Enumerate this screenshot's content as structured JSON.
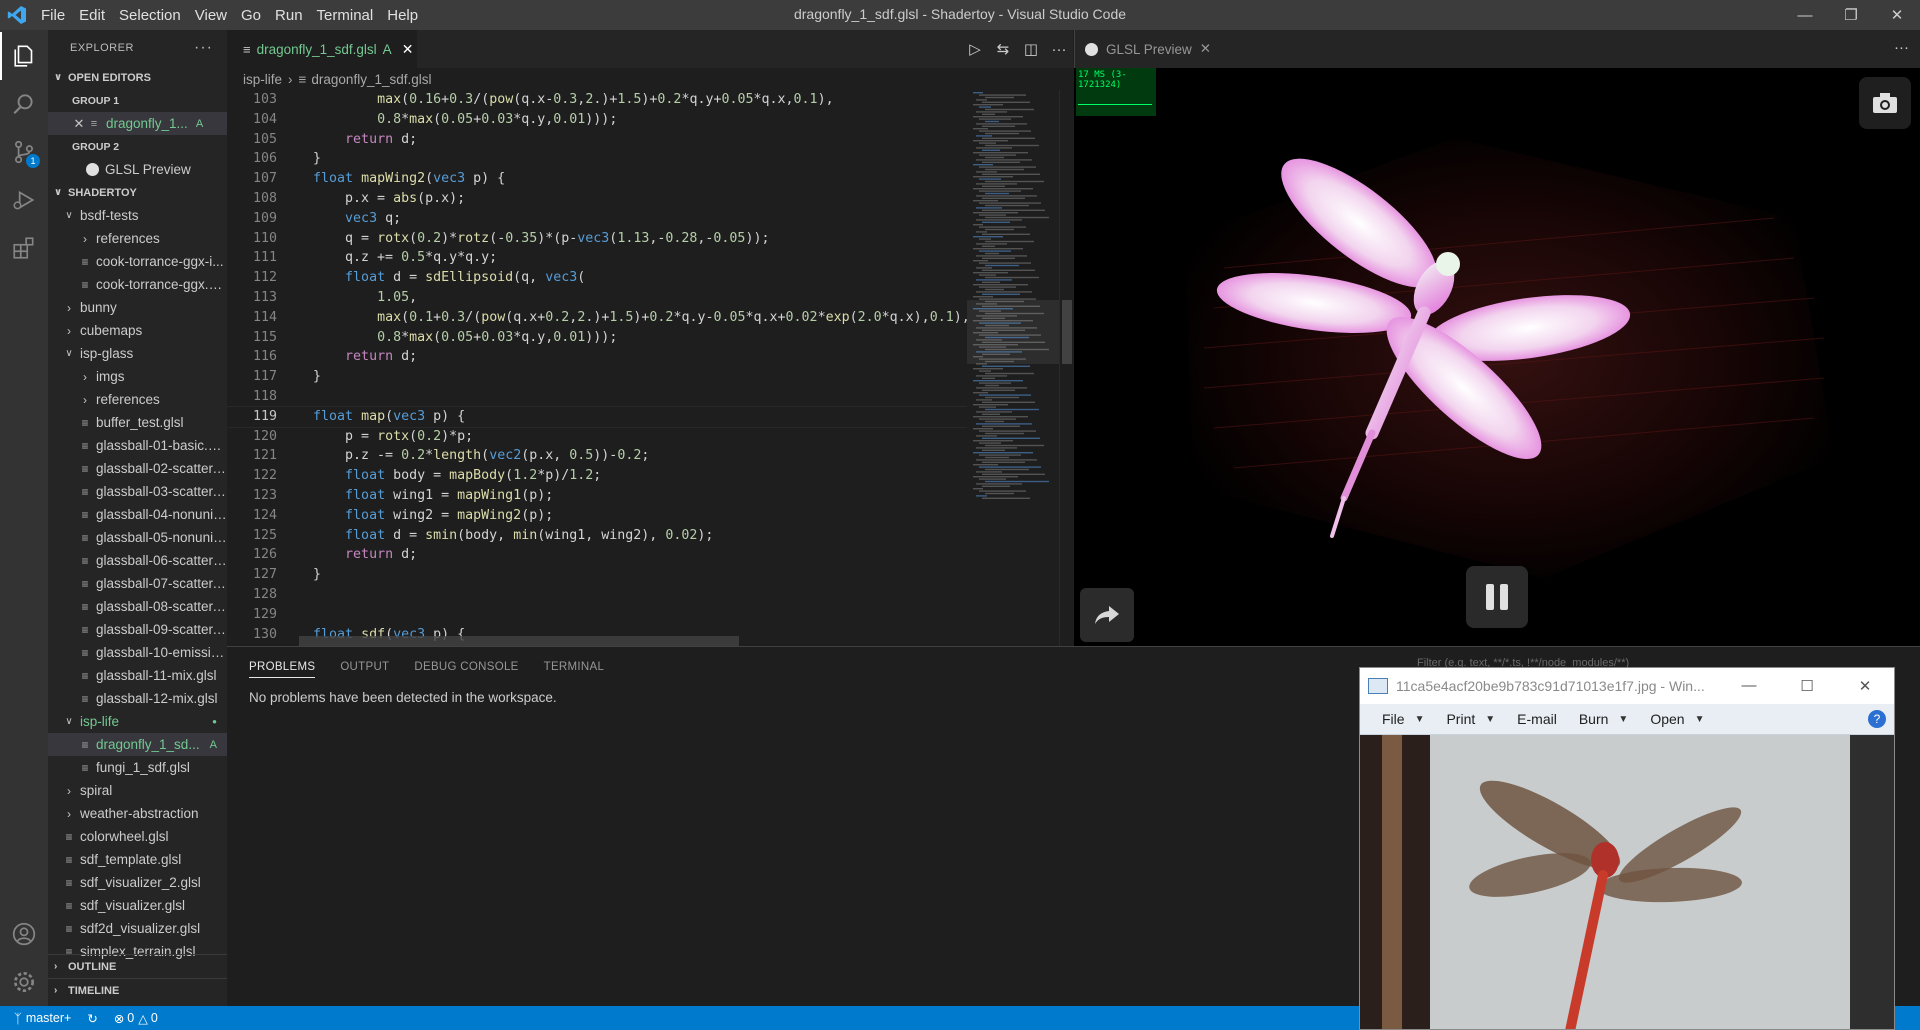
{
  "window": {
    "title": "dragonfly_1_sdf.glsl - Shadertoy - Visual Studio Code"
  },
  "menu": [
    "File",
    "Edit",
    "Selection",
    "View",
    "Go",
    "Run",
    "Terminal",
    "Help"
  ],
  "activity_badge": "1",
  "explorer": {
    "header": "EXPLORER",
    "open_editors": "OPEN EDITORS",
    "group1": "GROUP 1",
    "group1_file": "dragonfly_1...",
    "group1_status": "A",
    "group2": "GROUP 2",
    "group2_file": "GLSL Preview",
    "workspace": "SHADERTOY",
    "tree": [
      {
        "label": "bsdf-tests",
        "type": "folder-open",
        "indent": 1
      },
      {
        "label": "references",
        "type": "folder",
        "indent": 2
      },
      {
        "label": "cook-torrance-ggx-i...",
        "type": "file",
        "indent": 2
      },
      {
        "label": "cook-torrance-ggx.g...",
        "type": "file",
        "indent": 2
      },
      {
        "label": "bunny",
        "type": "folder",
        "indent": 1
      },
      {
        "label": "cubemaps",
        "type": "folder",
        "indent": 1
      },
      {
        "label": "isp-glass",
        "type": "folder-open",
        "indent": 1
      },
      {
        "label": "imgs",
        "type": "folder",
        "indent": 2
      },
      {
        "label": "references",
        "type": "folder",
        "indent": 2
      },
      {
        "label": "buffer_test.glsl",
        "type": "file",
        "indent": 2
      },
      {
        "label": "glassball-01-basic.glsl",
        "type": "file",
        "indent": 2
      },
      {
        "label": "glassball-02-scatter....",
        "type": "file",
        "indent": 2
      },
      {
        "label": "glassball-03-scatter....",
        "type": "file",
        "indent": 2
      },
      {
        "label": "glassball-04-nonunif...",
        "type": "file",
        "indent": 2
      },
      {
        "label": "glassball-05-nonunif...",
        "type": "file",
        "indent": 2
      },
      {
        "label": "glassball-06-scatter_...",
        "type": "file",
        "indent": 2
      },
      {
        "label": "glassball-07-scatter....",
        "type": "file",
        "indent": 2
      },
      {
        "label": "glassball-08-scatter....",
        "type": "file",
        "indent": 2
      },
      {
        "label": "glassball-09-scatter....",
        "type": "file",
        "indent": 2
      },
      {
        "label": "glassball-10-emissio...",
        "type": "file",
        "indent": 2
      },
      {
        "label": "glassball-11-mix.glsl",
        "type": "file",
        "indent": 2
      },
      {
        "label": "glassball-12-mix.glsl",
        "type": "file",
        "indent": 2
      },
      {
        "label": "isp-life",
        "type": "folder-open",
        "indent": 1,
        "green": true
      },
      {
        "label": "dragonfly_1_sd...",
        "type": "file",
        "indent": 2,
        "selected": true,
        "green": true,
        "status": "A"
      },
      {
        "label": "fungi_1_sdf.glsl",
        "type": "file",
        "indent": 2
      },
      {
        "label": "spiral",
        "type": "folder",
        "indent": 1
      },
      {
        "label": "weather-abstraction",
        "type": "folder",
        "indent": 1
      },
      {
        "label": "colorwheel.glsl",
        "type": "file",
        "indent": 1
      },
      {
        "label": "sdf_template.glsl",
        "type": "file",
        "indent": 1
      },
      {
        "label": "sdf_visualizer_2.glsl",
        "type": "file",
        "indent": 1
      },
      {
        "label": "sdf_visualizer.glsl",
        "type": "file",
        "indent": 1
      },
      {
        "label": "sdf2d_visualizer.glsl",
        "type": "file",
        "indent": 1
      },
      {
        "label": "simplex_terrain.glsl",
        "type": "file",
        "indent": 1
      }
    ],
    "outline": "OUTLINE",
    "timeline": "TIMELINE"
  },
  "editor": {
    "tab_label": "dragonfly_1_sdf.glsl",
    "tab_status": "A",
    "breadcrumb": [
      "isp-life",
      "dragonfly_1_sdf.glsl"
    ],
    "current_line": 119,
    "lines": [
      {
        "n": 103,
        "t": "          max(0.16+0.3/(pow(q.x-0.3,2.)+1.5)+0.2*q.y+0.05*q.x,0.1),"
      },
      {
        "n": 104,
        "t": "          0.8*max(0.05+0.03*q.y,0.01)));"
      },
      {
        "n": 105,
        "t": "      return d;"
      },
      {
        "n": 106,
        "t": "  }"
      },
      {
        "n": 107,
        "t": "  float mapWing2(vec3 p) {"
      },
      {
        "n": 108,
        "t": "      p.x = abs(p.x);"
      },
      {
        "n": 109,
        "t": "      vec3 q;"
      },
      {
        "n": 110,
        "t": "      q = rotx(0.2)*rotz(-0.35)*(p-vec3(1.13,-0.28,-0.05));"
      },
      {
        "n": 111,
        "t": "      q.z += 0.5*q.y*q.y;"
      },
      {
        "n": 112,
        "t": "      float d = sdEllipsoid(q, vec3("
      },
      {
        "n": 113,
        "t": "          1.05,"
      },
      {
        "n": 114,
        "t": "          max(0.1+0.3/(pow(q.x+0.2,2.)+1.5)+0.2*q.y-0.05*q.x+0.02*exp(2.0*q.x),0.1),"
      },
      {
        "n": 115,
        "t": "          0.8*max(0.05+0.03*q.y,0.01)));"
      },
      {
        "n": 116,
        "t": "      return d;"
      },
      {
        "n": 117,
        "t": "  }"
      },
      {
        "n": 118,
        "t": ""
      },
      {
        "n": 119,
        "t": "  float map(vec3 p) {"
      },
      {
        "n": 120,
        "t": "      p = rotx(0.2)*p;"
      },
      {
        "n": 121,
        "t": "      p.z -= 0.2*length(vec2(p.x, 0.5))-0.2;"
      },
      {
        "n": 122,
        "t": "      float body = mapBody(1.2*p)/1.2;"
      },
      {
        "n": 123,
        "t": "      float wing1 = mapWing1(p);"
      },
      {
        "n": 124,
        "t": "      float wing2 = mapWing2(p);"
      },
      {
        "n": 125,
        "t": "      float d = smin(body, min(wing1, wing2), 0.02);"
      },
      {
        "n": 126,
        "t": "      return d;"
      },
      {
        "n": 127,
        "t": "  }"
      },
      {
        "n": 128,
        "t": ""
      },
      {
        "n": 129,
        "t": ""
      },
      {
        "n": 130,
        "t": "  float sdf(vec3 p) {"
      }
    ]
  },
  "preview": {
    "tab_label": "GLSL Preview",
    "fps": "17 MS (3-1721324)"
  },
  "panel": {
    "tabs": [
      "PROBLEMS",
      "OUTPUT",
      "DEBUG CONSOLE",
      "TERMINAL"
    ],
    "active_tab": "PROBLEMS",
    "message": "No problems have been detected in the workspace.",
    "filter_placeholder": "Filter (e.g. text, **/*.ts, !**/node_modules/**)"
  },
  "status": {
    "branch": "master+",
    "errors": "0",
    "warnings": "0"
  },
  "photo_viewer": {
    "title": "11ca5e4acf20be9b783c91d71013e1f7.jpg - Win...",
    "menu": [
      "File",
      "Print",
      "E-mail",
      "Burn",
      "Open"
    ]
  },
  "colors": {
    "accent": "#007acc",
    "titlebar": "#3c3c3c",
    "sidebar": "#252526",
    "editor": "#1e1e1e",
    "wing": "#e889e0"
  }
}
